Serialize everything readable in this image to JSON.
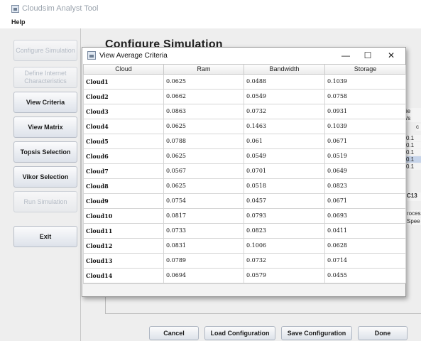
{
  "app": {
    "title": "Cloudsim Analyst Tool",
    "menu": [
      "Help"
    ]
  },
  "sidebar": {
    "buttons": [
      {
        "label": "Configure Simulation",
        "enabled": false
      },
      {
        "label": "Define Internet Characteristics",
        "enabled": false
      },
      {
        "label": "View Criteria",
        "enabled": true
      },
      {
        "label": "View Matrix",
        "enabled": true
      },
      {
        "label": "Topsis Selection",
        "enabled": true
      },
      {
        "label": "Vikor Selection",
        "enabled": true
      },
      {
        "label": "Run Simulation",
        "enabled": false
      },
      {
        "label": "Exit",
        "enabled": true
      }
    ]
  },
  "main": {
    "title": "Configure Simulation",
    "bottom_buttons": [
      "Cancel",
      "Load Configuration",
      "Save Configuration",
      "Done"
    ],
    "peek": {
      "col_header_1": "ie",
      "col_header_2": "/s",
      "col_header_3": "c",
      "values": [
        "0.1",
        "0.1",
        "0.1",
        "0.1",
        "0.1"
      ],
      "dc_label": "C13",
      "label_1": "roces",
      "label_2": "Spee"
    }
  },
  "dialog": {
    "title": "View Average Criteria",
    "controls": {
      "minimize": "—",
      "maximize": "☐",
      "close": "✕"
    },
    "columns": [
      "Cloud",
      "Ram",
      "Bandwidth",
      "Storage"
    ],
    "rows": [
      [
        "Cloud1",
        "0.0625",
        "0.0488",
        "0.1039"
      ],
      [
        "Cloud2",
        "0.0662",
        "0.0549",
        "0.0758"
      ],
      [
        "Cloud3",
        "0.0863",
        "0.0732",
        "0.0931"
      ],
      [
        "Cloud4",
        "0.0625",
        "0.1463",
        "0.1039"
      ],
      [
        "Cloud5",
        "0.0788",
        "0.061",
        "0.0671"
      ],
      [
        "Cloud6",
        "0.0625",
        "0.0549",
        "0.0519"
      ],
      [
        "Cloud7",
        "0.0567",
        "0.0701",
        "0.0649"
      ],
      [
        "Cloud8",
        "0.0625",
        "0.0518",
        "0.0823"
      ],
      [
        "Cloud9",
        "0.0754",
        "0.0457",
        "0.0671"
      ],
      [
        "Cloud10",
        "0.0817",
        "0.0793",
        "0.0693"
      ],
      [
        "Cloud11",
        "0.0733",
        "0.0823",
        "0.0411"
      ],
      [
        "Cloud12",
        "0.0831",
        "0.1006",
        "0.0628"
      ],
      [
        "Cloud13",
        "0.0789",
        "0.0732",
        "0.0714"
      ],
      [
        "Cloud14",
        "0.0694",
        "0.0579",
        "0.0455"
      ]
    ]
  }
}
